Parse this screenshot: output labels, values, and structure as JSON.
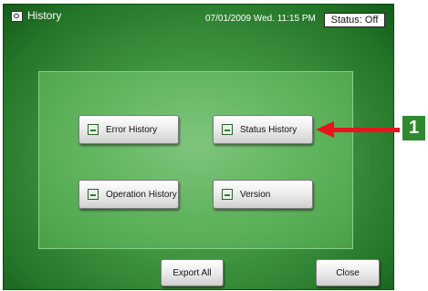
{
  "header": {
    "title": "History",
    "datetime": "07/01/2009 Wed. 11:15 PM",
    "status": "Status: Off"
  },
  "buttons": {
    "error_history": "Error History",
    "status_history": "Status History",
    "operation_history": "Operation History",
    "version": "Version",
    "export_all": "Export All",
    "close": "Close"
  },
  "callout": {
    "number": "1"
  },
  "colors": {
    "background": "#247628",
    "panel": "#5eb35c",
    "arrow": "#e8141e",
    "callout": "#2f8a2f"
  }
}
